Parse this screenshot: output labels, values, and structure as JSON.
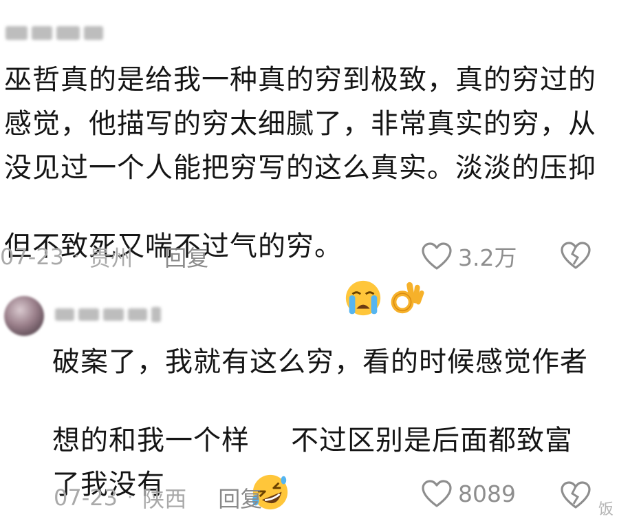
{
  "comments": [
    {
      "username": "",
      "text_part1": "巫哲真的是给我一种真的穷到极致，真的穷过的\n感觉，他描写的穷太细腻了，非常真实的穷，从\n没见过一个人能把穷写的这么真实。淡淡的压抑\n但不致死又喘不过气的穷。",
      "text_part2": "",
      "emojis": [
        "loudly-crying-face-emoji",
        "ok-hand-emoji"
      ],
      "date": "07-23",
      "location": "贵州",
      "reply_label": "回复",
      "like_count": "3.2万"
    },
    {
      "username": "",
      "text_part1": "破案了，我就有这么穷，看的时候感觉作者\n想的和我一个样",
      "text_part2": "不过区别是后面都致富\n了我没有",
      "emojis": [
        "rolling-on-floor-laughing-emoji"
      ],
      "date": "07-23",
      "location": "陕西",
      "reply_label": "回复",
      "like_count": "8089"
    }
  ],
  "separator": "·",
  "watermark": "饭",
  "colors": {
    "text": "#151515",
    "meta": "#a9a9a9",
    "reply": "#8a8a8a",
    "icon": "#8e8e8e"
  },
  "icons": [
    "heart-icon",
    "broken-heart-icon"
  ]
}
